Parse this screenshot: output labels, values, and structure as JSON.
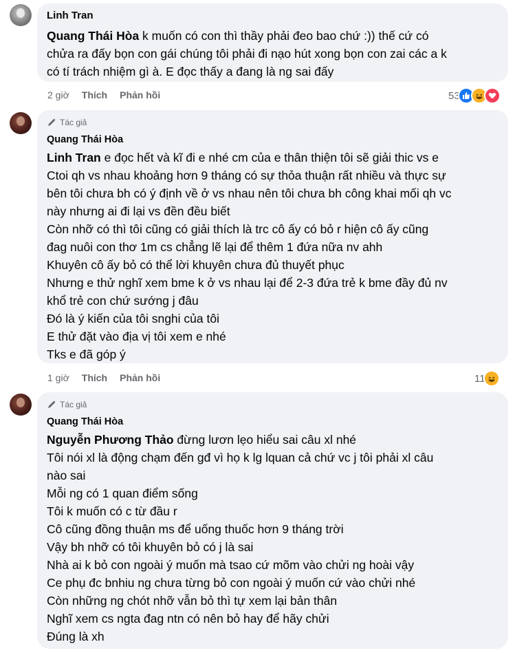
{
  "comments": [
    {
      "name": "Linh Tran",
      "mention": "Quang Thái Hòa",
      "first_line_rest": " k muốn có con thì thầy phải đeo bao chứ :)) thế cứ có",
      "lines": [
        "chửa ra đấy bọn con gái chúng tôi phải đi nạo hút xong bọn con zai các a k",
        "có tí trách nhiệm gì à. E đọc thấy a đang là ng sai đấy"
      ],
      "time": "2 giờ",
      "like": "Thích",
      "reply": "Phản hồi",
      "reaction_count": "53"
    },
    {
      "author_tag": "Tác giả",
      "name": "Quang Thái Hòa",
      "mention": "Linh Tran",
      "first_line_rest": " e đọc hết và kĩ đi e nhé cm của e thân thiện tôi sẽ giải thic vs e",
      "lines": [
        "Ctoi qh vs nhau khoảng hơn 9 tháng có sự thỏa thuận rất nhiều và thực sự",
        "bên tôi chưa bh có ý định về ở vs nhau nên tôi chưa bh công khai mối qh vc",
        "này nhưng ai đi lại vs đền đều biết",
        "Còn nhỡ có thì tôi cũng có giải thích là trc cô ấy có bỏ r hiện cô ấy cũng",
        "đag nuôi con thơ 1m cs chẳng lẽ lại để thêm 1 đứa nữa nv ahh",
        "Khuyên cô ấy bỏ có thể lời khuyên chưa đủ thuyết phục",
        "Nhưng e thử nghĩ xem bme k ở vs nhau lại để 2-3 đứa trẻ k bme đầy đủ nv",
        "khổ trẻ con chứ sướng j đâu",
        "Đó là ý kiến của tôi snghi của tôi",
        "E thử đặt vào địa vị tôi xem e nhé",
        "Tks e đã góp ý"
      ],
      "time": "1 giờ",
      "like": "Thích",
      "reply": "Phản hồi",
      "reaction_count": "11"
    },
    {
      "author_tag": "Tác giả",
      "name": "Quang Thái Hòa",
      "mention": "Nguyễn Phương Thảo",
      "first_line_rest": " đừng lươn lẹo hiểu sai câu xl nhé",
      "lines": [
        "Tôi nói xl là động chạm đến gđ vì họ k lg lquan cả chứ vc j tôi phải xl câu",
        "nào sai",
        "Mỗi ng có 1 quan điểm sống",
        "Tôi k muốn có c từ đầu r",
        "Cô cũng đồng thuận ms để uống thuốc hơn 9 tháng trời",
        "Vậy bh nhỡ có tôi khuyên bỏ có j là sai",
        "Nhà ai k bỏ con ngoài ý muốn mà tsao cứ mõm vào chửi ng hoài vậy",
        "Ce phụ đc bnhiu ng chưa từng bỏ con ngoài ý muốn cứ vào chửi nhé",
        "Còn những ng chót nhỡ vẫn bỏ thì tự xem lại bản thân",
        "Nghĩ xem cs ngta đag ntn có nên bỏ hay để hãy chửi",
        "Đúng là xh"
      ]
    }
  ],
  "icons": {
    "pen": "pen-icon",
    "like": "like-reaction-icon",
    "haha": "haha-reaction-icon",
    "love": "love-reaction-icon"
  },
  "colors": {
    "bubble": "#f0f2f5",
    "meta": "#65676b",
    "like": "#1877f2",
    "haha": "#f7b125",
    "love": "#f33e58"
  }
}
